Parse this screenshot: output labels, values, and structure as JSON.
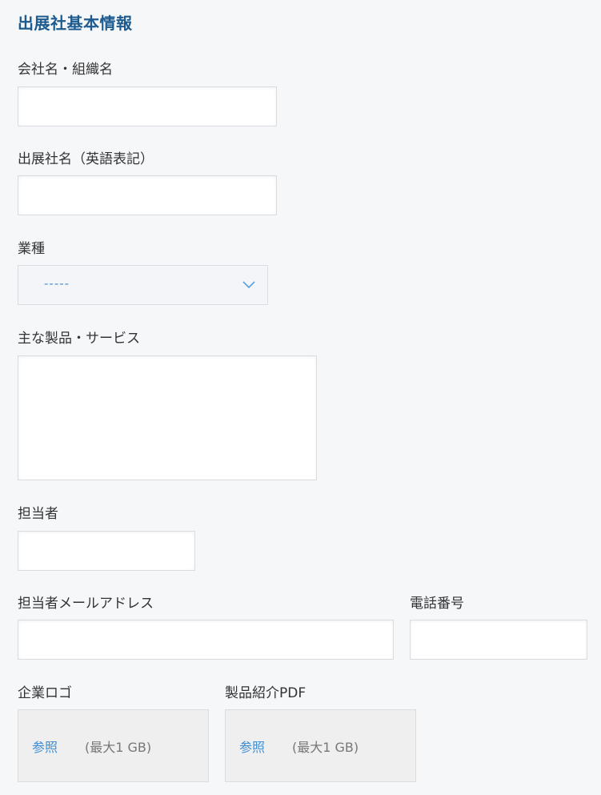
{
  "section": {
    "title": "出展社基本情報"
  },
  "fields": {
    "company_name": {
      "label": "会社名・組織名",
      "value": ""
    },
    "exhibitor_name_en": {
      "label": "出展社名（英語表記）",
      "value": ""
    },
    "industry": {
      "label": "業種",
      "selected": "-----"
    },
    "products_services": {
      "label": "主な製品・サービス",
      "value": ""
    },
    "contact_person": {
      "label": "担当者",
      "value": ""
    },
    "contact_email": {
      "label": "担当者メールアドレス",
      "value": ""
    },
    "phone": {
      "label": "電話番号",
      "value": ""
    }
  },
  "uploads": {
    "logo": {
      "label": "企業ロゴ",
      "browse": "参照",
      "max_size": "(最大1 GB)"
    },
    "pdf": {
      "label": "製品紹介PDF",
      "browse": "参照",
      "max_size": "(最大1 GB)"
    }
  },
  "colors": {
    "title": "#1d5a8e",
    "link": "#3d8ed4",
    "background": "#f6f7f9",
    "border": "#d9dce0"
  },
  "icons": {
    "select_arrow": "chevron-down-icon"
  }
}
